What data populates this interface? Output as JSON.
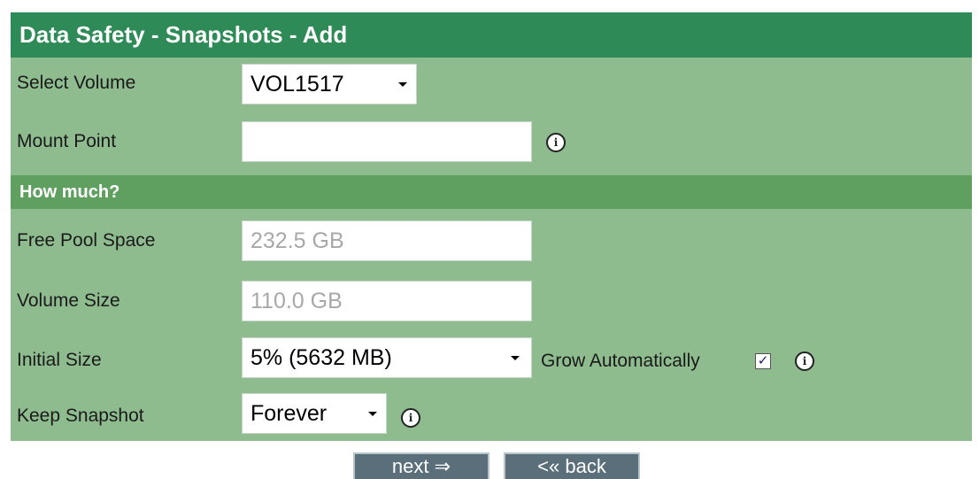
{
  "header": {
    "title": "Data Safety - Snapshots - Add"
  },
  "fields": {
    "select_volume": {
      "label": "Select Volume",
      "value": "VOL1517"
    },
    "mount_point": {
      "label": "Mount Point",
      "value": ""
    }
  },
  "section": {
    "title": "How much?"
  },
  "how_much": {
    "free_pool_space": {
      "label": "Free Pool Space",
      "value": "232.5 GB"
    },
    "volume_size": {
      "label": "Volume Size",
      "value": "110.0 GB"
    },
    "initial_size": {
      "label": "Initial Size",
      "value": "5% (5632 MB)"
    },
    "grow_automatically": {
      "label": "Grow Automatically",
      "checked": true
    },
    "keep_snapshot": {
      "label": "Keep Snapshot",
      "value": "Forever"
    }
  },
  "buttons": {
    "next": "next ⇒",
    "back": "<« back"
  },
  "colors": {
    "header": "#2e8b57",
    "panel": "#8fbc8f",
    "section": "#5f9f5f",
    "button": "#5b6f7b"
  },
  "icons": [
    "info-icon",
    "chevron-down-icon",
    "checkmark-icon",
    "arrow-right-icon"
  ]
}
